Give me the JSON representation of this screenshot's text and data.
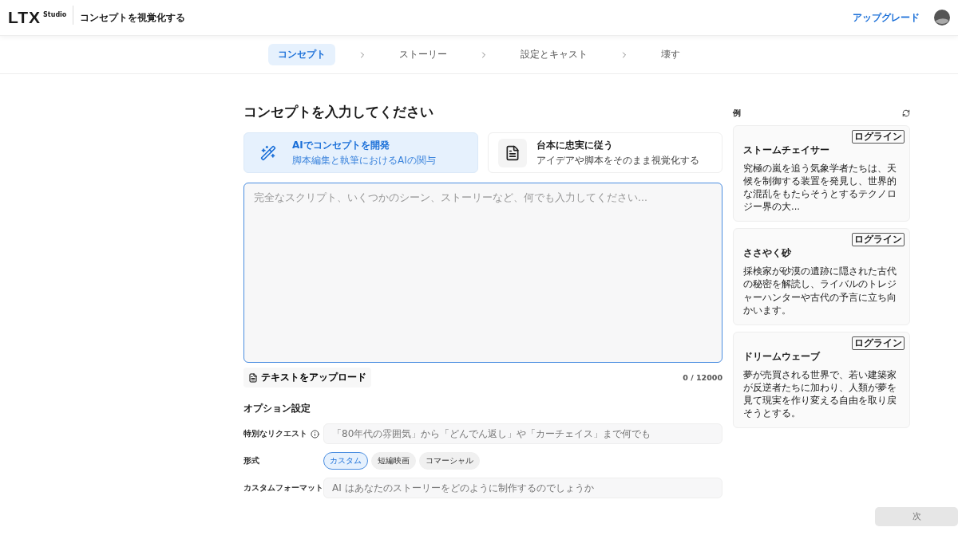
{
  "header": {
    "logo": "LTX",
    "logo_sub": "Studio",
    "title": "コンセプトを視覚化する",
    "upgrade": "アップグレード"
  },
  "steps": [
    {
      "label": "コンセプト",
      "selected": true
    },
    {
      "label": "ストーリー",
      "selected": false
    },
    {
      "label": "設定とキャスト",
      "selected": false
    },
    {
      "label": "壊す",
      "selected": false
    }
  ],
  "heading": "コンセプトを入力してください",
  "modes": [
    {
      "kind": "ai",
      "title": "AIでコンセプトを開発",
      "subtitle": "脚本編集と執筆におけるAIの関与",
      "selected": true
    },
    {
      "kind": "script",
      "title": "台本に忠実に従う",
      "subtitle": "アイデアや脚本をそのまま視覚化する",
      "selected": false
    }
  ],
  "concept_field": {
    "placeholder": "完全なスクリプト、いくつかのシーン、ストーリーなど、何でも入力してください..."
  },
  "upload_button": "テキストをアップロード",
  "char_count": "0 / 12000",
  "options": {
    "title": "オプション設定",
    "special_request": {
      "label": "特別なリクエスト",
      "placeholder": "「80年代の雰囲気」から「どんでん返し」や「カーチェイス」まで何でも"
    },
    "format": {
      "label": "形式",
      "choices": [
        {
          "label": "カスタム",
          "selected": true
        },
        {
          "label": "短編映画",
          "selected": false
        },
        {
          "label": "コマーシャル",
          "selected": false
        }
      ]
    },
    "custom_format": {
      "label": "カスタムフォーマット",
      "placeholder": "AI はあなたのストーリーをどのように制作するのでしょうか"
    }
  },
  "examples": {
    "title": "例",
    "items": [
      {
        "tag": "ログライン",
        "title": "ストームチェイサー",
        "text": "究極の嵐を追う気象学者たちは、天候を制御する装置を発見し、世界的な混乱をもたらそうとするテクノロジー界の大..."
      },
      {
        "tag": "ログライン",
        "title": "ささやく砂",
        "text": "採検家が砂漠の遺跡に隠された古代の秘密を解読し、ライバルのトレジャーハンターや古代の予言に立ち向かいます。"
      },
      {
        "tag": "ログライン",
        "title": "ドリームウェーブ",
        "text": "夢が売買される世界で、若い建築家が反逆者たちに加わり、人類が夢を見て現実を作り変える自由を取り戻そうとする。"
      }
    ]
  },
  "next_button": "次"
}
